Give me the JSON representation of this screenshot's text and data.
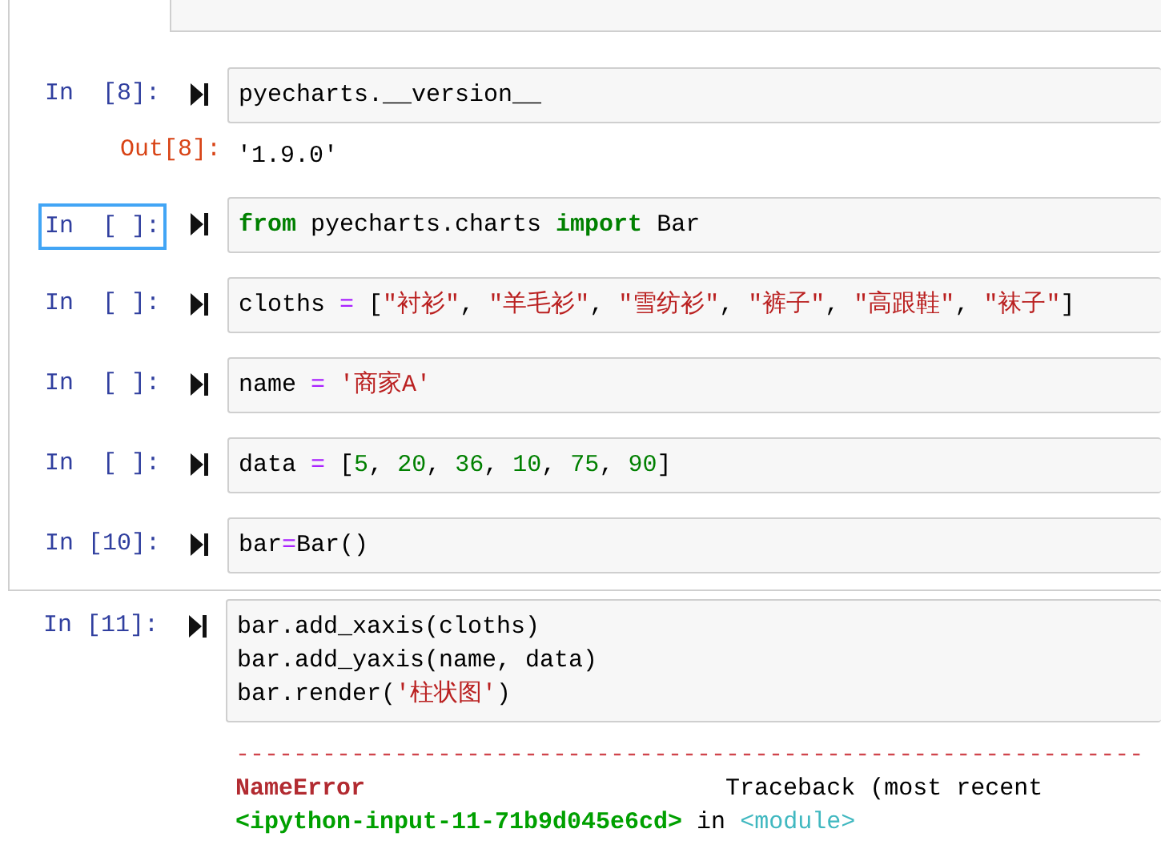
{
  "cells": [
    {
      "prompt": "In  [8]:",
      "selected": false,
      "lines": [
        [
          {
            "kind": "plain",
            "s": "pyecharts.__version__"
          }
        ]
      ],
      "output": {
        "prompt": "Out[8]:",
        "lines": [
          [
            {
              "kind": "plain",
              "s": "'1.9.0'"
            }
          ]
        ]
      }
    },
    {
      "prompt": "In  [ ]:",
      "selected": true,
      "lines": [
        [
          {
            "kind": "keyword",
            "s": "from"
          },
          {
            "kind": "plain",
            "s": " pyecharts.charts "
          },
          {
            "kind": "keyword",
            "s": "import"
          },
          {
            "kind": "plain",
            "s": " Bar"
          }
        ]
      ]
    },
    {
      "prompt": "In  [ ]:",
      "selected": false,
      "lines": [
        [
          {
            "kind": "plain",
            "s": "cloths "
          },
          {
            "kind": "operator",
            "s": "="
          },
          {
            "kind": "plain",
            "s": " ["
          },
          {
            "kind": "string",
            "s": "\"衬衫\""
          },
          {
            "kind": "plain",
            "s": ", "
          },
          {
            "kind": "string",
            "s": "\"羊毛衫\""
          },
          {
            "kind": "plain",
            "s": ", "
          },
          {
            "kind": "string",
            "s": "\"雪纺衫\""
          },
          {
            "kind": "plain",
            "s": ", "
          },
          {
            "kind": "string",
            "s": "\"裤子\""
          },
          {
            "kind": "plain",
            "s": ", "
          },
          {
            "kind": "string",
            "s": "\"高跟鞋\""
          },
          {
            "kind": "plain",
            "s": ", "
          },
          {
            "kind": "string",
            "s": "\"袜子\""
          },
          {
            "kind": "plain",
            "s": "]"
          }
        ]
      ]
    },
    {
      "prompt": "In  [ ]:",
      "selected": false,
      "lines": [
        [
          {
            "kind": "plain",
            "s": "name "
          },
          {
            "kind": "operator",
            "s": "="
          },
          {
            "kind": "string",
            "s": " '商家A'"
          }
        ]
      ]
    },
    {
      "prompt": "In  [ ]:",
      "selected": false,
      "lines": [
        [
          {
            "kind": "plain",
            "s": "data "
          },
          {
            "kind": "operator",
            "s": "="
          },
          {
            "kind": "plain",
            "s": " ["
          },
          {
            "kind": "number",
            "s": "5"
          },
          {
            "kind": "plain",
            "s": ", "
          },
          {
            "kind": "number",
            "s": "20"
          },
          {
            "kind": "plain",
            "s": ", "
          },
          {
            "kind": "number",
            "s": "36"
          },
          {
            "kind": "plain",
            "s": ", "
          },
          {
            "kind": "number",
            "s": "10"
          },
          {
            "kind": "plain",
            "s": ", "
          },
          {
            "kind": "number",
            "s": "75"
          },
          {
            "kind": "plain",
            "s": ", "
          },
          {
            "kind": "number",
            "s": "90"
          },
          {
            "kind": "plain",
            "s": "]"
          }
        ]
      ]
    },
    {
      "prompt": "In [10]:",
      "selected": false,
      "lines": [
        [
          {
            "kind": "plain",
            "s": "bar"
          },
          {
            "kind": "operator",
            "s": "="
          },
          {
            "kind": "plain",
            "s": "Bar()"
          }
        ]
      ]
    },
    {
      "prompt": "In [11]:",
      "selected": false,
      "lines": [
        [
          {
            "kind": "plain",
            "s": "bar.add_xaxis(cloths)"
          }
        ],
        [
          {
            "kind": "plain",
            "s": "bar.add_yaxis(name, data)"
          }
        ],
        [
          {
            "kind": "plain",
            "s": "bar.render("
          },
          {
            "kind": "string",
            "s": "'柱状图'"
          },
          {
            "kind": "plain",
            "s": ")"
          }
        ]
      ],
      "output": {
        "lines": [
          [
            {
              "kind": "rule",
              "s": "---------------------------------------------------------------"
            }
          ],
          [
            {
              "kind": "error",
              "s": "NameError"
            },
            {
              "kind": "plain",
              "s": "                         Traceback (most recent"
            }
          ],
          [
            {
              "kind": "path",
              "s": "<ipython-input-11-71b9d045e6cd>"
            },
            {
              "kind": "plain",
              "s": " in "
            },
            {
              "kind": "module",
              "s": "<module>"
            }
          ]
        ]
      }
    }
  ]
}
